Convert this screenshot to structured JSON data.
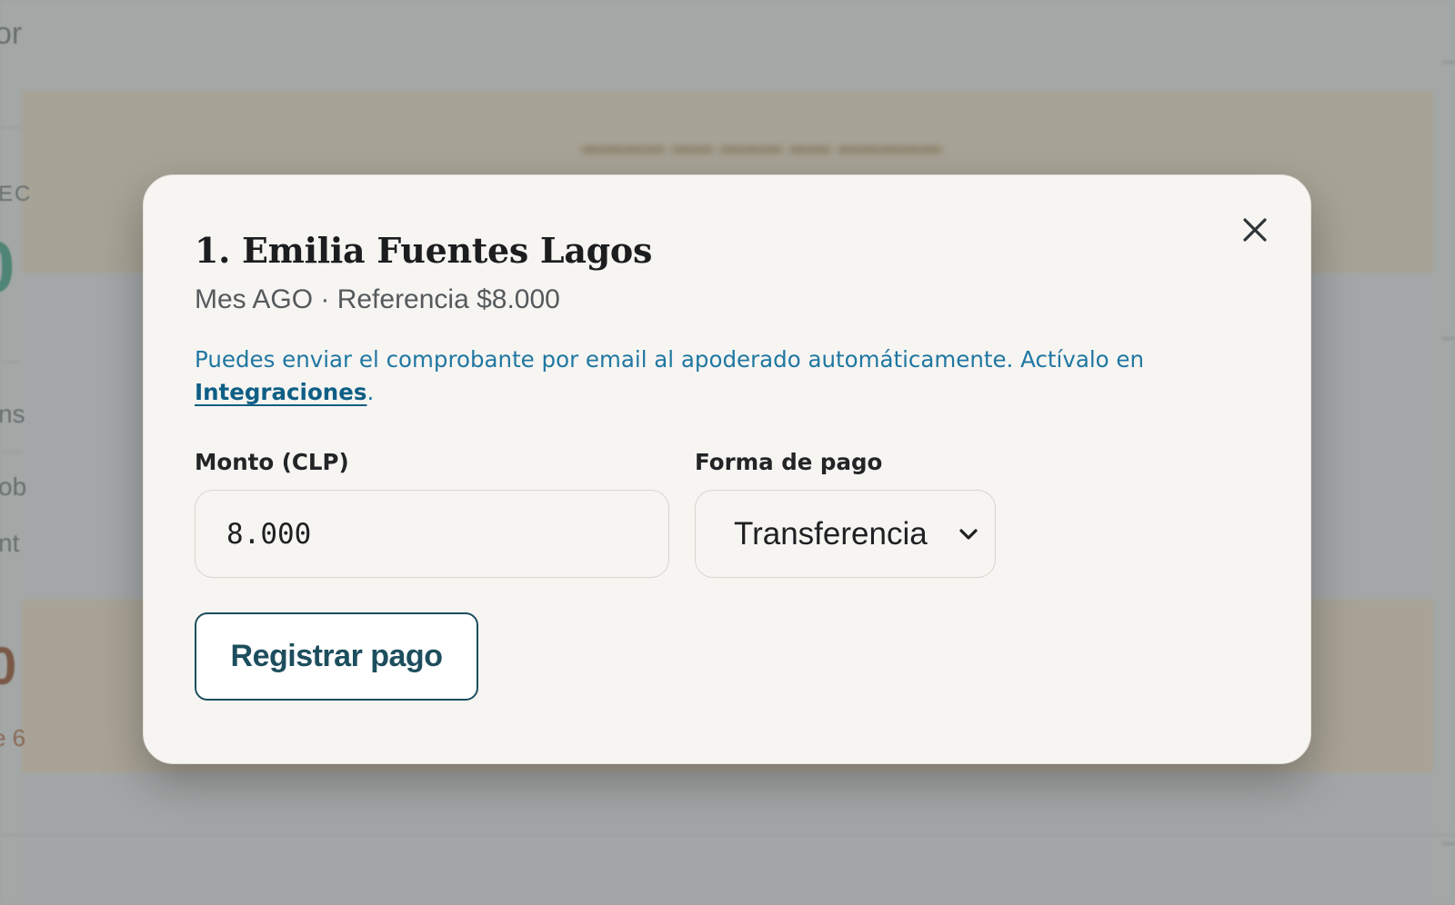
{
  "background": {
    "fragment_top": "or",
    "fragment_label": "EC",
    "big_number_green": "0",
    "fragment_ns": "ns",
    "fragment_ob": "ob",
    "fragment_nt": "nt",
    "big_number_brown": "0",
    "fragment_e6": "e 6"
  },
  "modal": {
    "title": "1. Emilia Fuentes Lagos",
    "subtitle": "Mes AGO · Referencia $8.000",
    "info_text": "Puedes enviar el comprobante por email al apoderado automáticamente. Actívalo en ",
    "info_link": "Integraciones",
    "info_suffix": ".",
    "amount_label": "Monto (CLP)",
    "amount_value": "8.000",
    "payment_label": "Forma de pago",
    "payment_value": "Transferencia",
    "submit_label": "Registrar pago",
    "close_icon": "close-icon"
  },
  "colors": {
    "link": "#1f77a2",
    "button_border": "#1d4e5e",
    "modal_bg": "#f7f5f2"
  }
}
